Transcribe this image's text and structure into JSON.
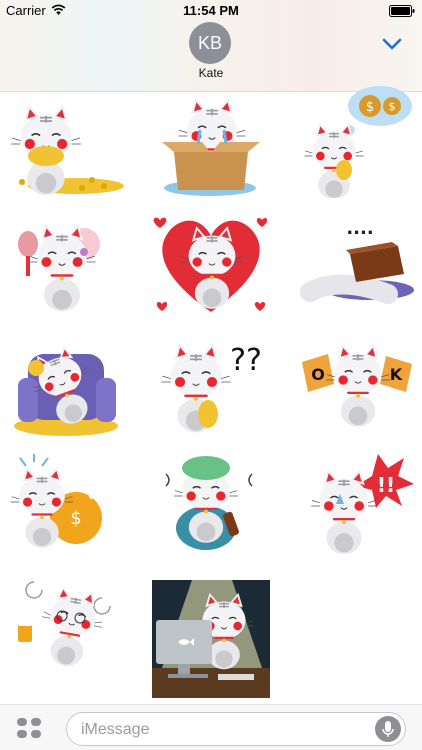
{
  "status_bar": {
    "carrier": "Carrier",
    "time": "11:54 PM"
  },
  "header": {
    "avatar_initials": "KB",
    "contact_name": "Kate",
    "accent_color": "#1f6fd1"
  },
  "stickers": [
    {
      "name": "cat-gold-coins"
    },
    {
      "name": "cat-crying-box"
    },
    {
      "name": "cat-dreaming-money"
    },
    {
      "name": "cat-mirror-blush"
    },
    {
      "name": "cat-heart-love"
    },
    {
      "name": "cat-chocolate-sleep"
    },
    {
      "name": "cat-armchair-gold"
    },
    {
      "name": "cat-question-coin"
    },
    {
      "name": "cat-ok-signs"
    },
    {
      "name": "cat-money-bag"
    },
    {
      "name": "cat-sick-medicine"
    },
    {
      "name": "cat-angry-exclaim"
    },
    {
      "name": "cat-dizzy-beer"
    },
    {
      "name": "cat-computer-night"
    }
  ],
  "bubbles": {
    "dots": "....",
    "question": "??",
    "ok_left": "O",
    "ok_right": "K",
    "exclaim": "!!"
  },
  "compose": {
    "placeholder": "iMessage"
  }
}
